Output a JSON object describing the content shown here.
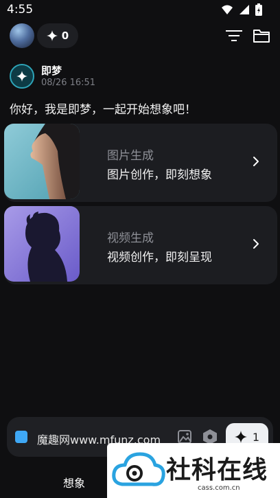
{
  "status_bar": {
    "time": "4:55"
  },
  "header": {
    "credits": "0"
  },
  "message": {
    "bot_name": "即梦",
    "timestamp": "08/26 16:51",
    "text": "你好，我是即梦，一起开始想象吧！"
  },
  "cards": [
    {
      "title": "图片生成",
      "subtitle": "图片创作，即刻想象"
    },
    {
      "title": "视频生成",
      "subtitle": "视频创作，即刻呈现"
    }
  ],
  "input": {
    "value": "魔趣网www.mfunz.com",
    "generate_count": "1"
  },
  "bottom_nav": {
    "tab_imagine": "想象"
  },
  "watermark": {
    "text": "社科在线",
    "url": "cass.com.cn"
  },
  "colors": {
    "background": "#0f0f11",
    "card": "#1c1d21",
    "accent_blue": "#3fa8f5"
  }
}
